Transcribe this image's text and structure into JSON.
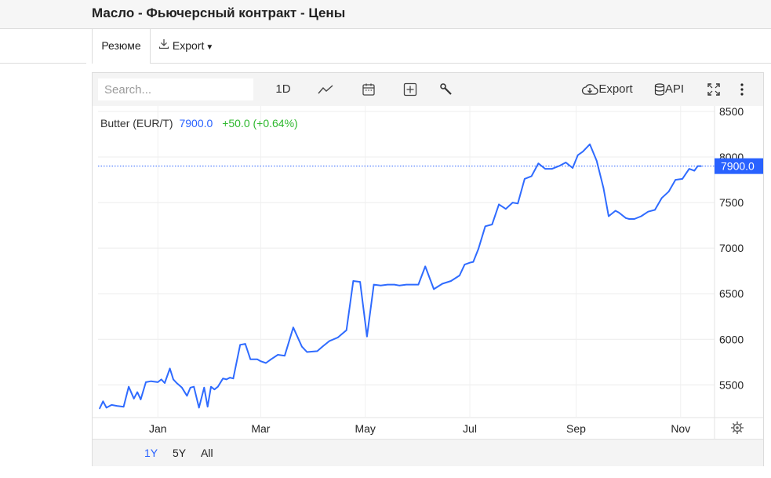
{
  "header": {
    "title": "Масло - Фьючерсный контракт - Цены"
  },
  "tabs": {
    "summary": "Резюме",
    "export": "Export"
  },
  "toolbar": {
    "search_placeholder": "Search...",
    "interval": "1D",
    "export_label": "Export",
    "api_label": "API",
    "icons": [
      "line-chart-icon",
      "calendar-icon",
      "add-indicator-icon",
      "wrench-icon",
      "cloud-download-icon",
      "database-icon",
      "fullscreen-icon",
      "more-icon"
    ]
  },
  "legend": {
    "symbol": "Butter (EUR/T)",
    "last": "7900.0",
    "change": "+50.0 (+0.64%)"
  },
  "price_badge": "7900.0",
  "ranges": [
    "1Y",
    "5Y",
    "All"
  ],
  "colors": {
    "line": "#2f6bff",
    "change": "#2eb82e",
    "badge": "#2962ff",
    "active_range": "#2962ff"
  },
  "chart_data": {
    "type": "line",
    "title": "",
    "xlabel": "",
    "ylabel": "",
    "x_tick_labels": [
      "Jan",
      "Mar",
      "May",
      "Jul",
      "Sep",
      "Nov"
    ],
    "y_ticks": [
      5500,
      6000,
      6500,
      7000,
      7500,
      8000,
      8500
    ],
    "ylim": [
      5150,
      8560
    ],
    "grid": true,
    "x": [
      "2023-11-28",
      "2023-11-30",
      "2023-12-02",
      "2023-12-05",
      "2023-12-08",
      "2023-12-12",
      "2023-12-15",
      "2023-12-18",
      "2023-12-20",
      "2023-12-22",
      "2023-12-25",
      "2023-12-28",
      "2024-01-01",
      "2024-01-03",
      "2024-01-05",
      "2024-01-08",
      "2024-01-10",
      "2024-01-12",
      "2024-01-15",
      "2024-01-18",
      "2024-01-20",
      "2024-01-22",
      "2024-01-25",
      "2024-01-28",
      "2024-01-30",
      "2024-02-01",
      "2024-02-03",
      "2024-02-05",
      "2024-02-08",
      "2024-02-10",
      "2024-02-12",
      "2024-02-14",
      "2024-02-18",
      "2024-02-21",
      "2024-02-24",
      "2024-02-28",
      "2024-03-01",
      "2024-03-04",
      "2024-03-07",
      "2024-03-11",
      "2024-03-15",
      "2024-03-20",
      "2024-03-25",
      "2024-03-28",
      "2024-04-03",
      "2024-04-06",
      "2024-04-10",
      "2024-04-15",
      "2024-04-20",
      "2024-04-24",
      "2024-04-28",
      "2024-05-02",
      "2024-05-06",
      "2024-05-10",
      "2024-05-14",
      "2024-05-18",
      "2024-05-21",
      "2024-05-25",
      "2024-05-29",
      "2024-06-01",
      "2024-06-05",
      "2024-06-10",
      "2024-06-15",
      "2024-06-20",
      "2024-06-25",
      "2024-06-28",
      "2024-07-01",
      "2024-07-03",
      "2024-07-06",
      "2024-07-10",
      "2024-07-14",
      "2024-07-18",
      "2024-07-22",
      "2024-07-26",
      "2024-07-29",
      "2024-08-02",
      "2024-08-06",
      "2024-08-10",
      "2024-08-14",
      "2024-08-18",
      "2024-08-22",
      "2024-08-26",
      "2024-08-30",
      "2024-09-02",
      "2024-09-05",
      "2024-09-09",
      "2024-09-13",
      "2024-09-17",
      "2024-09-20",
      "2024-09-24",
      "2024-09-26",
      "2024-09-30",
      "2024-10-02",
      "2024-10-05",
      "2024-10-09",
      "2024-10-13",
      "2024-10-17",
      "2024-10-21",
      "2024-10-25",
      "2024-10-29",
      "2024-11-02",
      "2024-11-06",
      "2024-11-09",
      "2024-11-11",
      "2024-11-13"
    ],
    "series": [
      {
        "name": "",
        "values": [
          5240,
          5320,
          5250,
          5280,
          5270,
          5260,
          5480,
          5350,
          5420,
          5340,
          5530,
          5540,
          5530,
          5560,
          5520,
          5680,
          5560,
          5520,
          5470,
          5380,
          5470,
          5480,
          5250,
          5470,
          5260,
          5480,
          5450,
          5480,
          5570,
          5560,
          5580,
          5570,
          5940,
          5950,
          5780,
          5780,
          5760,
          5740,
          5780,
          5830,
          5820,
          6130,
          5920,
          5860,
          5870,
          5920,
          5980,
          6020,
          6100,
          6640,
          6630,
          6030,
          6600,
          6590,
          6600,
          6600,
          6590,
          6600,
          6600,
          6600,
          6800,
          6550,
          6610,
          6640,
          6700,
          6820,
          6840,
          6850,
          6990,
          7240,
          7260,
          7480,
          7430,
          7500,
          7490,
          7760,
          7790,
          7930,
          7870,
          7870,
          7900,
          7940,
          7880,
          8020,
          8060,
          8140,
          7960,
          7660,
          7350,
          7410,
          7390,
          7330,
          7320,
          7320,
          7350,
          7400,
          7420,
          7550,
          7620,
          7750,
          7760,
          7870,
          7850,
          7900,
          7900
        ]
      }
    ]
  }
}
